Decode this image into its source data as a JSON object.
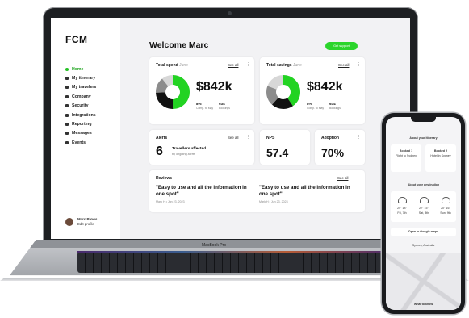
{
  "app": {
    "logo": "FCM",
    "welcome": "Welcome Marc",
    "action_button": "Get support"
  },
  "sidebar": {
    "items": [
      {
        "label": "Home",
        "icon": "home-icon",
        "active": true
      },
      {
        "label": "My itinerary",
        "icon": "itinerary-icon"
      },
      {
        "label": "My travelers",
        "icon": "travelers-icon"
      },
      {
        "label": "Company",
        "icon": "company-icon"
      },
      {
        "label": "Security",
        "icon": "security-icon"
      },
      {
        "label": "Integrations",
        "icon": "integrations-icon"
      },
      {
        "label": "Reporting",
        "icon": "reporting-icon"
      },
      {
        "label": "Messages",
        "icon": "messages-icon"
      },
      {
        "label": "Events",
        "icon": "events-icon"
      }
    ],
    "user": {
      "name": "Marc Blows",
      "link": "Edit profile"
    }
  },
  "cards": {
    "total_spend": {
      "title": "Total spend",
      "sub": "June",
      "see_all": "See all",
      "value": "$842k",
      "stat1_value": "8%",
      "stat1_label": "Comp. to May",
      "stat2_value": "934",
      "stat2_label": "Bookings"
    },
    "total_savings": {
      "title": "Total savings",
      "sub": "June",
      "see_all": "See all",
      "value": "$842k",
      "stat1_value": "8%",
      "stat1_label": "Comp. to May",
      "stat2_value": "934",
      "stat2_label": "Bookings"
    },
    "alerts": {
      "title": "Alerts",
      "see_all": "See all",
      "count": "6",
      "line1": "Travellers affected",
      "line2": "by ongoing alerts"
    },
    "nps": {
      "title": "NPS",
      "value": "57.4"
    },
    "adoption": {
      "title": "Adoption",
      "value": "70%"
    },
    "reviews": {
      "title": "Reviews",
      "see_all": "See all",
      "items": [
        {
          "quote": "\"Easy to use and all the information in one spot\"",
          "meta": "Mark H • Jun 23, 2023"
        },
        {
          "quote": "\"Easy to use and all the information in one spot\"",
          "meta": "Mark H • Jun 23, 2023"
        }
      ]
    }
  },
  "laptop": {
    "brand": "MacBook Pro"
  },
  "donut_colors": {
    "green": "#22d322",
    "black": "#111111",
    "grey": "#8c8c8c",
    "light": "#d7d7d7"
  },
  "phone": {
    "heading": "About your itinerary",
    "left_title": "Booked 1",
    "left_line": "Flight to Sydney",
    "right_title": "Booked 2",
    "right_line": "Hotel in Sydney",
    "weather_heading": "About your destination",
    "weather": [
      {
        "temp": "24° 18°",
        "day": "Fri, 7th"
      },
      {
        "temp": "22° 15°",
        "day": "Sat, 8th"
      },
      {
        "temp": "20° 16°",
        "day": "Sun, 9th"
      }
    ],
    "open_button": "Open in Google maps",
    "map_label": "Sydney, Australia",
    "footer": "What to know"
  }
}
